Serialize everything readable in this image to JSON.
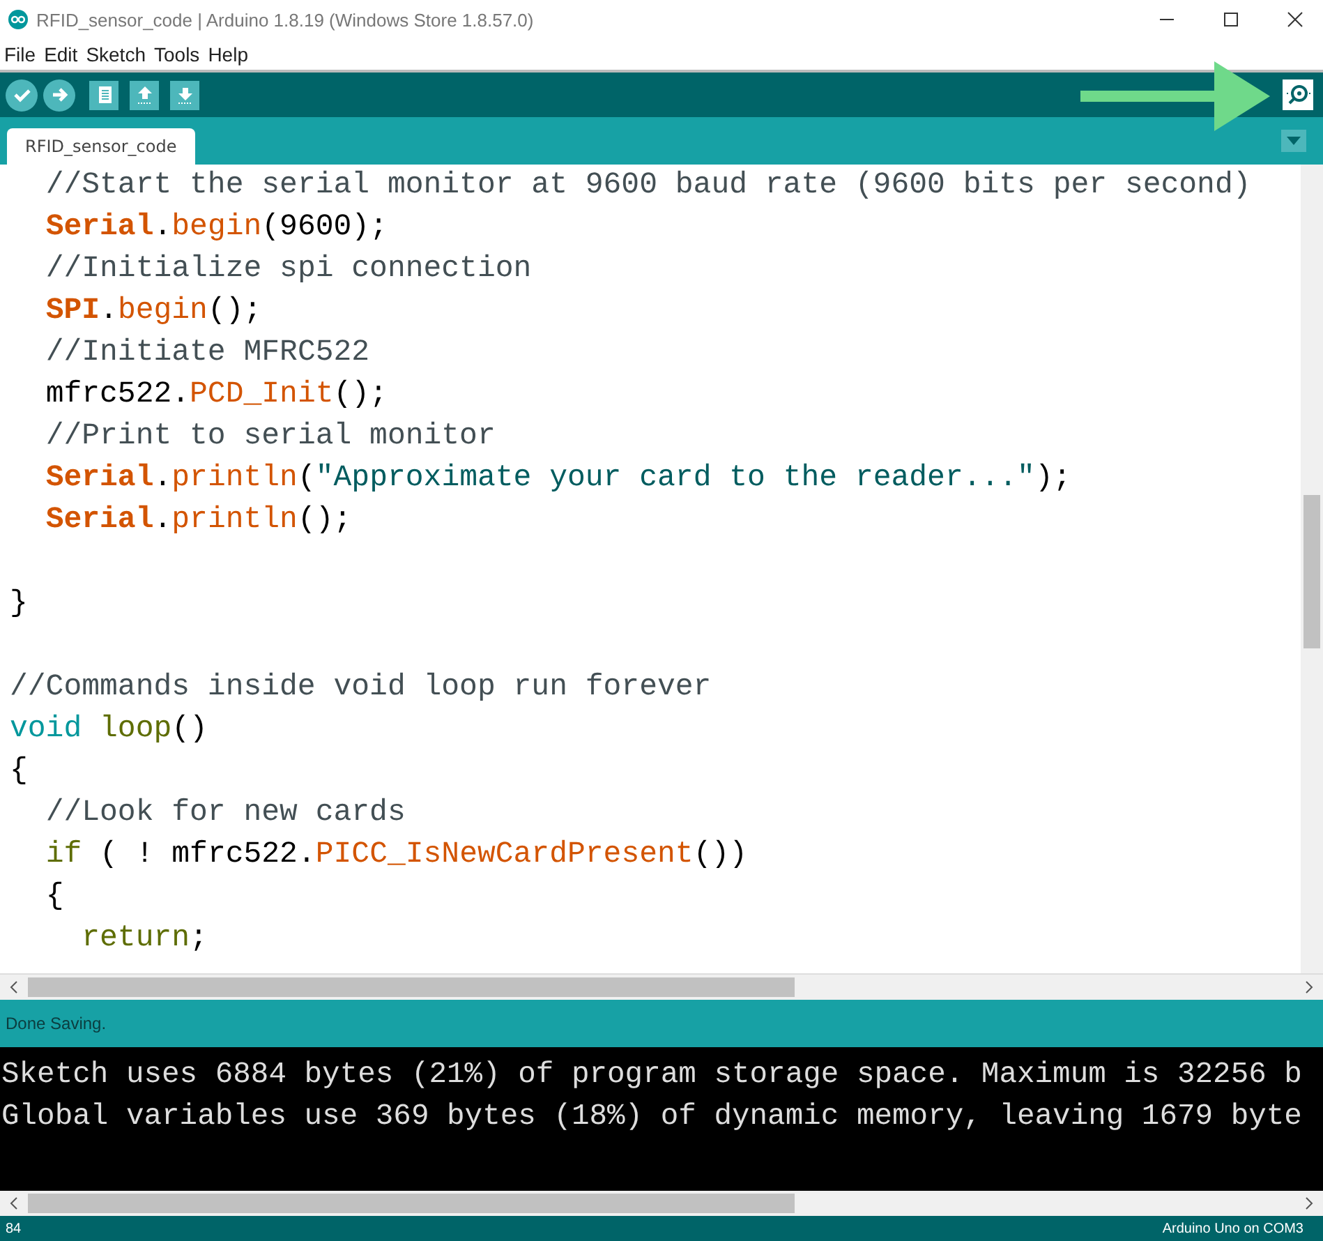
{
  "window": {
    "title": "RFID_sensor_code | Arduino 1.8.19 (Windows Store 1.8.57.0)"
  },
  "menu": [
    "File",
    "Edit",
    "Sketch",
    "Tools",
    "Help"
  ],
  "toolbar": {
    "buttons": [
      {
        "kind": "verify"
      },
      {
        "kind": "upload"
      },
      {
        "kind": "new"
      },
      {
        "kind": "open"
      },
      {
        "kind": "save"
      }
    ],
    "serial_monitor": {
      "highlighted": true
    }
  },
  "tabs": [
    {
      "label": "RFID_sensor_code",
      "selected": true
    }
  ],
  "editor": {
    "lines": [
      {
        "kind": "code",
        "tokens": [
          {
            "kind": "comment",
            "s": "  //Start the serial monitor at 9600 baud rate (9600 bits per second)"
          }
        ]
      },
      {
        "kind": "code",
        "tokens": [
          {
            "kind": "keyword",
            "s": "  Serial"
          },
          {
            "kind": "plain",
            "s": "."
          },
          {
            "kind": "function",
            "s": "begin"
          },
          {
            "kind": "plain",
            "s": "(9600);"
          }
        ]
      },
      {
        "kind": "code",
        "tokens": [
          {
            "kind": "comment",
            "s": "  //Initialize spi connection"
          }
        ]
      },
      {
        "kind": "code",
        "tokens": [
          {
            "kind": "keyword",
            "s": "  SPI"
          },
          {
            "kind": "plain",
            "s": "."
          },
          {
            "kind": "function",
            "s": "begin"
          },
          {
            "kind": "plain",
            "s": "();"
          }
        ]
      },
      {
        "kind": "code",
        "tokens": [
          {
            "kind": "comment",
            "s": "  //Initiate MFRC522"
          }
        ]
      },
      {
        "kind": "code",
        "tokens": [
          {
            "kind": "plain",
            "s": "  mfrc522."
          },
          {
            "kind": "function",
            "s": "PCD_Init"
          },
          {
            "kind": "plain",
            "s": "();"
          }
        ]
      },
      {
        "kind": "code",
        "tokens": [
          {
            "kind": "comment",
            "s": "  //Print to serial monitor"
          }
        ]
      },
      {
        "kind": "code",
        "tokens": [
          {
            "kind": "keyword",
            "s": "  Serial"
          },
          {
            "kind": "plain",
            "s": "."
          },
          {
            "kind": "function",
            "s": "println"
          },
          {
            "kind": "plain",
            "s": "("
          },
          {
            "kind": "string",
            "s": "\"Approximate your card to the reader...\""
          },
          {
            "kind": "plain",
            "s": ");"
          }
        ]
      },
      {
        "kind": "code",
        "tokens": [
          {
            "kind": "keyword",
            "s": "  Serial"
          },
          {
            "kind": "plain",
            "s": "."
          },
          {
            "kind": "function",
            "s": "println"
          },
          {
            "kind": "plain",
            "s": "();"
          }
        ]
      },
      {
        "kind": "blank"
      },
      {
        "kind": "code",
        "tokens": [
          {
            "kind": "plain",
            "s": "}"
          }
        ]
      },
      {
        "kind": "blank"
      },
      {
        "kind": "code",
        "tokens": [
          {
            "kind": "comment",
            "s": "//Commands inside void loop run forever"
          }
        ]
      },
      {
        "kind": "code",
        "tokens": [
          {
            "kind": "type",
            "s": "void"
          },
          {
            "kind": "control",
            "s": " loop"
          },
          {
            "kind": "plain",
            "s": "()"
          }
        ]
      },
      {
        "kind": "code",
        "tokens": [
          {
            "kind": "plain",
            "s": "{"
          }
        ]
      },
      {
        "kind": "code",
        "tokens": [
          {
            "kind": "comment",
            "s": "  //Look for new cards"
          }
        ]
      },
      {
        "kind": "code",
        "tokens": [
          {
            "kind": "control",
            "s": "  if"
          },
          {
            "kind": "plain",
            "s": " ( ! mfrc522."
          },
          {
            "kind": "function",
            "s": "PICC_IsNewCardPresent"
          },
          {
            "kind": "plain",
            "s": "())"
          }
        ]
      },
      {
        "kind": "code",
        "tokens": [
          {
            "kind": "plain",
            "s": "  {"
          }
        ]
      },
      {
        "kind": "code",
        "tokens": [
          {
            "kind": "control",
            "s": "    return"
          },
          {
            "kind": "plain",
            "s": ";"
          }
        ]
      }
    ]
  },
  "message": "Done Saving.",
  "console": [
    "Sketch uses 6884 bytes (21%) of program storage space. Maximum is 32256 b",
    "Global variables use 369 bytes (18%) of dynamic memory, leaving 1679 byte"
  ],
  "status_bar": {
    "line": "84",
    "board": "Arduino Uno on COM3"
  }
}
